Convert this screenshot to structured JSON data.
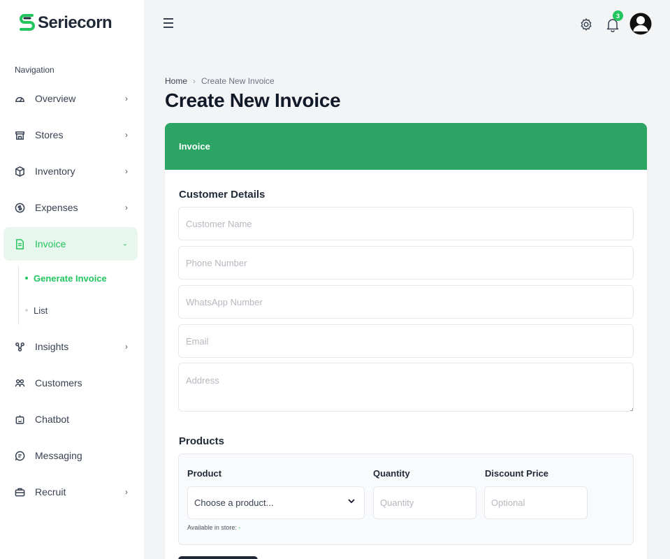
{
  "brand": {
    "name": "Seriecorn",
    "color": "#22c55e"
  },
  "sidebar": {
    "heading": "Navigation",
    "items": [
      {
        "label": "Overview",
        "icon": "gauge-icon"
      },
      {
        "label": "Stores",
        "icon": "store-icon"
      },
      {
        "label": "Inventory",
        "icon": "box-icon"
      },
      {
        "label": "Expenses",
        "icon": "dollar-circle-icon"
      },
      {
        "label": "Invoice",
        "icon": "file-icon"
      },
      {
        "label": "Insights",
        "icon": "network-icon"
      },
      {
        "label": "Customers",
        "icon": "users-icon"
      },
      {
        "label": "Chatbot",
        "icon": "bot-icon"
      },
      {
        "label": "Messaging",
        "icon": "message-icon"
      },
      {
        "label": "Recruit",
        "icon": "briefcase-icon"
      }
    ],
    "invoice_sub": [
      {
        "label": "Generate Invoice"
      },
      {
        "label": "List"
      }
    ]
  },
  "topbar": {
    "notification_count": "3"
  },
  "breadcrumb": {
    "home": "Home",
    "separator": "›",
    "current": "Create New Invoice"
  },
  "page": {
    "title": "Create New Invoice"
  },
  "card": {
    "header": "Invoice",
    "customer_section": "Customer Details",
    "customer_name_placeholder": "Customer Name",
    "phone_placeholder": "Phone Number",
    "whatsapp_placeholder": "WhatsApp Number",
    "email_placeholder": "Email",
    "address_placeholder": "Address",
    "products_section": "Products",
    "product_label": "Product",
    "product_select": "Choose a product...",
    "quantity_label": "Quantity",
    "quantity_placeholder": "Quantity",
    "discount_label": "Discount Price",
    "discount_placeholder": "Optional",
    "available_label": "Available in store:",
    "available_value": "-"
  }
}
